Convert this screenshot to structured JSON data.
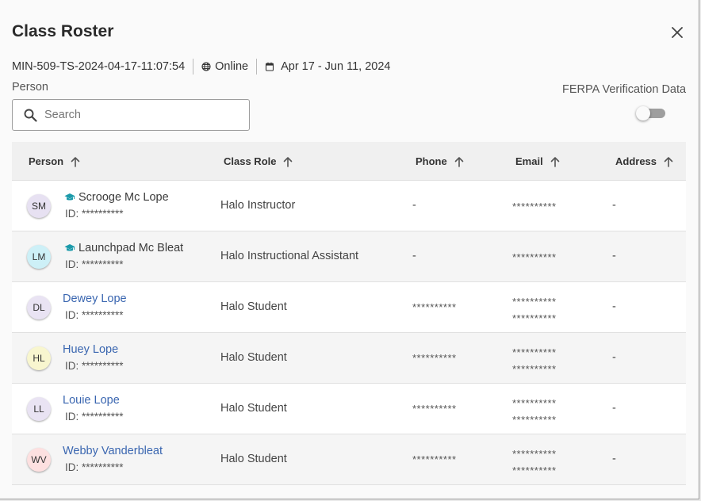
{
  "dialog": {
    "title": "Class Roster",
    "close_icon": "close-icon"
  },
  "meta": {
    "class_code": "MIN-509-TS-2024-04-17-11:07:54",
    "modality": "Online",
    "modality_icon": "globe-icon",
    "date_range": "Apr 17 - Jun 11, 2024",
    "date_icon": "calendar-icon"
  },
  "filter": {
    "person_label": "Person",
    "search_placeholder": "Search",
    "search_value": ""
  },
  "ferpa": {
    "label": "FERPA Verification Data",
    "enabled": false
  },
  "table": {
    "columns": [
      {
        "label": "Person",
        "sort_icon": "arrow-up-icon"
      },
      {
        "label": "Class Role",
        "sort_icon": "arrow-up-icon"
      },
      {
        "label": "Phone",
        "sort_icon": "arrow-up-icon"
      },
      {
        "label": "Email",
        "sort_icon": "arrow-up-icon"
      },
      {
        "label": "Address",
        "sort_icon": "arrow-up-icon"
      }
    ],
    "rows": [
      {
        "initials": "SM",
        "avatar_color": "#e7e1f2",
        "name": "Scrooge Mc Lope",
        "is_link": false,
        "staff_icon": "graduation-cap-icon",
        "id": "ID: **********",
        "role": "Halo Instructor",
        "phone": "-",
        "emails": [
          "**********"
        ],
        "address": "-"
      },
      {
        "initials": "LM",
        "avatar_color": "#cdf0f7",
        "name": "Launchpad Mc Bleat",
        "is_link": false,
        "staff_icon": "graduation-cap-icon",
        "id": "ID: **********",
        "role": "Halo Instructional Assistant",
        "phone": "-",
        "emails": [
          "**********"
        ],
        "address": "-"
      },
      {
        "initials": "DL",
        "avatar_color": "#e9e3f3",
        "name": "Dewey Lope",
        "is_link": true,
        "staff_icon": "",
        "id": "ID: **********",
        "role": "Halo Student",
        "phone": "**********",
        "emails": [
          "**********",
          "**********"
        ],
        "address": "-"
      },
      {
        "initials": "HL",
        "avatar_color": "#f8f6cf",
        "name": "Huey Lope",
        "is_link": true,
        "staff_icon": "",
        "id": "ID: **********",
        "role": "Halo Student",
        "phone": "**********",
        "emails": [
          "**********",
          "**********"
        ],
        "address": "-"
      },
      {
        "initials": "LL",
        "avatar_color": "#e9e3f3",
        "name": "Louie Lope",
        "is_link": true,
        "staff_icon": "",
        "id": "ID: **********",
        "role": "Halo Student",
        "phone": "**********",
        "emails": [
          "**********",
          "**********"
        ],
        "address": "-"
      },
      {
        "initials": "WV",
        "avatar_color": "#fde0e0",
        "name": "Webby Vanderbleat",
        "is_link": true,
        "staff_icon": "",
        "id": "ID: **********",
        "role": "Halo Student",
        "phone": "**********",
        "emails": [
          "**********",
          "**********"
        ],
        "address": "-"
      }
    ]
  },
  "colors": {
    "link": "#3a66b0",
    "staff_icon": "#1b9aaa",
    "toggle_track": "#9e9e9e"
  }
}
